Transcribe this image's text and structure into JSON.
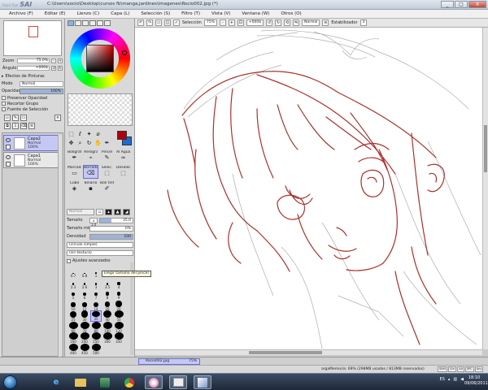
{
  "window": {
    "brand_small": "Paint Tool",
    "brand": "SAI",
    "title": "C:\\Users\\socio\\Desktop\\cursos fb\\manga,jardines\\imagenes\\Rocio002.jpg (*)",
    "buttons": [
      "_",
      "□",
      "X"
    ]
  },
  "menu": [
    "Archivo (F)",
    "Editar (E)",
    "Lienzo (C)",
    "Capa (L)",
    "Selección (S)",
    "Filtro (T)",
    "Vista (V)",
    "Ventana (W)",
    "Otros (O)"
  ],
  "navigator": {
    "zoom_label": "Zoom",
    "zoom_value": "75.0%",
    "angle_label": "Ángulo",
    "angle_value": "+000$"
  },
  "layer_panel": {
    "effects_label": "Efectos de Pinturas",
    "mode_label": "Modo",
    "mode_value": "Normal",
    "opacity_label": "Opacidad",
    "opacity_value": "100%",
    "opacity_fraction": 1.0,
    "checkboxes": [
      "Preservar Opacidad",
      "Recortar Grupo",
      "Fuente de Selección"
    ],
    "layers": [
      {
        "name": "Capa2",
        "mode": "Normal",
        "opacity": "100%",
        "selected": true
      },
      {
        "name": "Capa1",
        "mode": "Normal",
        "opacity": "100%",
        "selected": false
      }
    ]
  },
  "colors": {
    "primary": "#b00010",
    "secondary": "#1f6bd0",
    "line_color": "#a8322e",
    "sketch_color": "#9a9a9a"
  },
  "brushes": [
    {
      "name": "Bolígrafo",
      "icon": "✒"
    },
    {
      "name": "Aerógrafo",
      "icon": "⌁"
    },
    {
      "name": "Pincel",
      "icon": "✎"
    },
    {
      "name": "Al Agua",
      "icon": "≈"
    },
    {
      "name": "Marcador",
      "icon": "▭"
    },
    {
      "name": "Borrador",
      "icon": "⌫",
      "selected": true
    },
    {
      "name": "Selec.",
      "icon": "⬚"
    },
    {
      "name": "Deselec.",
      "icon": "⬚"
    },
    {
      "name": "Cubo",
      "icon": "◈"
    },
    {
      "name": "Binario",
      "icon": "▪"
    },
    {
      "name": "Boli tinta",
      "icon": "✐"
    }
  ],
  "tool_options": {
    "blend_mode": "Normal",
    "size_label": "Tamaño",
    "size_multiplier": "x 1.0",
    "size_value": "35.0",
    "size_fraction": 0.35,
    "min_size_label": "Tamaño min.",
    "min_size_value": "0%",
    "density_label": "Densidad",
    "density_value": "100",
    "shape_value": "(círculo simple)",
    "texture_value": "(sin textura)",
    "advanced_label": "Ajustes avanzados",
    "tooltip": "Elegir tamaño del pincel"
  },
  "size_presets": [
    "0.7",
    "0.8",
    "1",
    "1.5",
    "2",
    "2.3",
    "2.6",
    "3",
    "3.5",
    "4",
    "5",
    "6",
    "7",
    "8",
    "9",
    "10",
    "12",
    "14",
    "16",
    "20",
    "25",
    "30",
    "35",
    "40",
    "50",
    "60",
    "70",
    "80",
    "100",
    "120",
    "160",
    "200",
    "250",
    "300",
    "350",
    "400",
    "450",
    "500"
  ],
  "toolbar": {
    "selection_label": "Selección",
    "selection_zoom": "75%",
    "angle": "+000$",
    "mode": "Normal",
    "stabilizer_label": "Estabilizador",
    "stabilizer_value": "3"
  },
  "document": {
    "tab_name": "Rocio002.jpg",
    "tab_zoom": "75%"
  },
  "status": {
    "memory": "argaMemoria: 69% (298MB usados / 813MB reservados)",
    "keys": [
      "Shift",
      "Ctrl",
      "Alt",
      "SPC",
      "Any"
    ]
  },
  "taskbar": {
    "apps": [
      "ie",
      "folder",
      "media",
      "chrome",
      "photos",
      "paint",
      "sai"
    ],
    "lang": "ES",
    "time": "18:10",
    "date": "09/06/2011"
  }
}
